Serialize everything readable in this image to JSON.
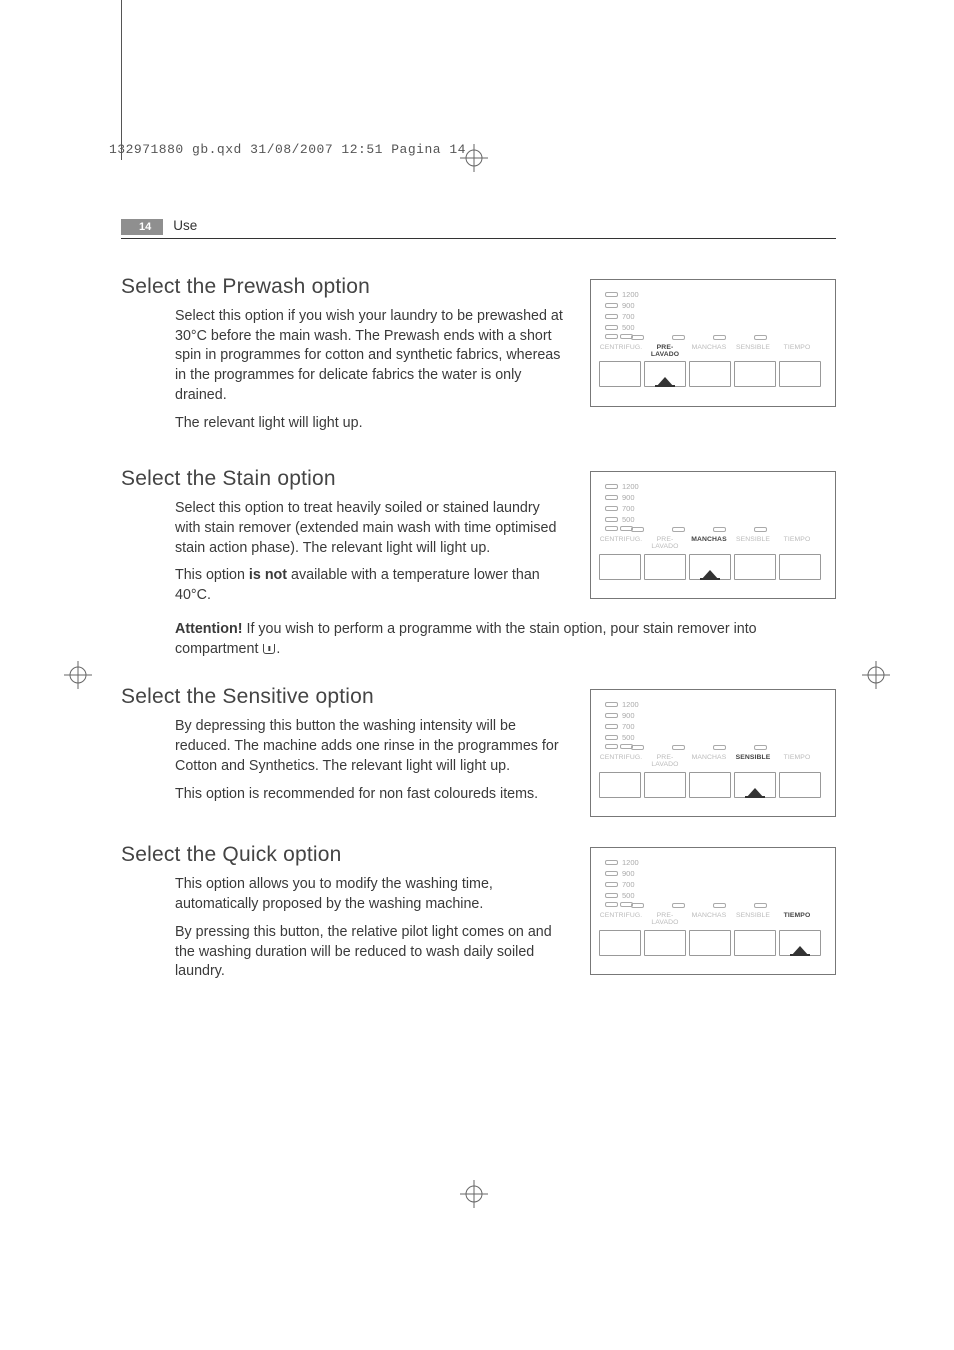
{
  "print_header": "132971880 gb.qxd  31/08/2007  12:51  Pagina 14",
  "page_number": "14",
  "running_head": "Use",
  "panel": {
    "spins": [
      "1200",
      "900",
      "700",
      "500"
    ],
    "labels": {
      "centrifug": "CENTRIFUG.",
      "prelavado": "PRE-\nLAVADO",
      "manchas": "MANCHAS",
      "sensible": "SENSIBLE",
      "tiempo": "TIEMPO"
    }
  },
  "sections": [
    {
      "title": "Select the Prewash option",
      "paras": [
        "Select this option if you wish your laundry to be prewashed at 30°C before the main wash. The Prewash ends with a short spin in programmes for cotton and synthetic fabrics, whereas in the programmes for delicate fabrics the water is only drained.",
        "The relevant light will light up."
      ],
      "active": "prelavado"
    },
    {
      "title": "Select the Stain option",
      "paras": [
        "Select this option to treat heavily soiled or stained laundry with stain remover (extended main wash with time optimised stain action phase). The relevant light will light up.",
        "This option <strong>is not</strong> available with a temperature lower than 40°C.",
        "<strong>Attention!</strong> If you wish to perform a programme with the stain option, pour stain remover into compartment <span class=\"compartment-icon\" data-name=\"compartment-icon\" data-interactable=\"false\"></span>."
      ],
      "active": "manchas"
    },
    {
      "title": "Select the Sensitive option",
      "paras": [
        "By depressing this button the washing intensity will be reduced. The machine adds one rinse in the programmes for Cotton and Synthetics. The relevant light will light up.",
        "This option is recommended for non fast coloureds items."
      ],
      "active": "sensible"
    },
    {
      "title": "Select the Quick option",
      "paras": [
        "This option allows you to modify the washing time, automatically proposed by the washing machine.",
        "By pressing this button, the relative pilot light comes on and the washing duration will be reduced to wash daily soiled laundry."
      ],
      "active": "tiempo"
    }
  ]
}
